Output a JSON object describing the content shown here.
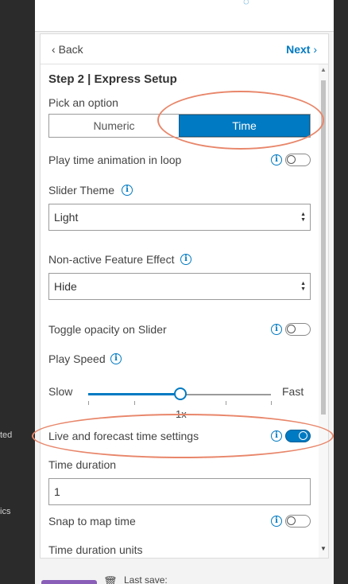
{
  "left_sidebar": {
    "fragments": [
      "ted",
      "ics"
    ]
  },
  "nav": {
    "back_label": "Back",
    "next_label": "Next"
  },
  "step": {
    "title": "Step 2 | Express Setup"
  },
  "pick_option": {
    "label": "Pick an option",
    "options": [
      "Numeric",
      "Time"
    ],
    "selected": "Time"
  },
  "settings": {
    "loop": {
      "label": "Play time animation in loop",
      "enabled": false
    },
    "slider_theme": {
      "label": "Slider Theme",
      "value": "Light"
    },
    "nonactive_effect": {
      "label": "Non-active Feature Effect",
      "value": "Hide"
    },
    "toggle_opacity": {
      "label": "Toggle opacity on Slider",
      "enabled": false
    },
    "play_speed": {
      "label": "Play Speed",
      "min_label": "Slow",
      "max_label": "Fast",
      "value_label": "1x",
      "value_fraction": 0.5
    },
    "live_forecast": {
      "label": "Live and forecast time settings",
      "enabled": true
    },
    "time_duration": {
      "label": "Time duration",
      "value": "1"
    },
    "snap_map_time": {
      "label": "Snap to map time",
      "enabled": false
    },
    "time_duration_units": {
      "label": "Time duration units"
    }
  },
  "footer": {
    "last_save_label": "Last save:"
  },
  "colors": {
    "accent": "#007ac2",
    "highlight_ring": "#e8866a"
  },
  "icons": {
    "info": "info-icon",
    "delete": "trash-icon",
    "back": "chevron-left-icon",
    "next": "chevron-right-icon"
  }
}
